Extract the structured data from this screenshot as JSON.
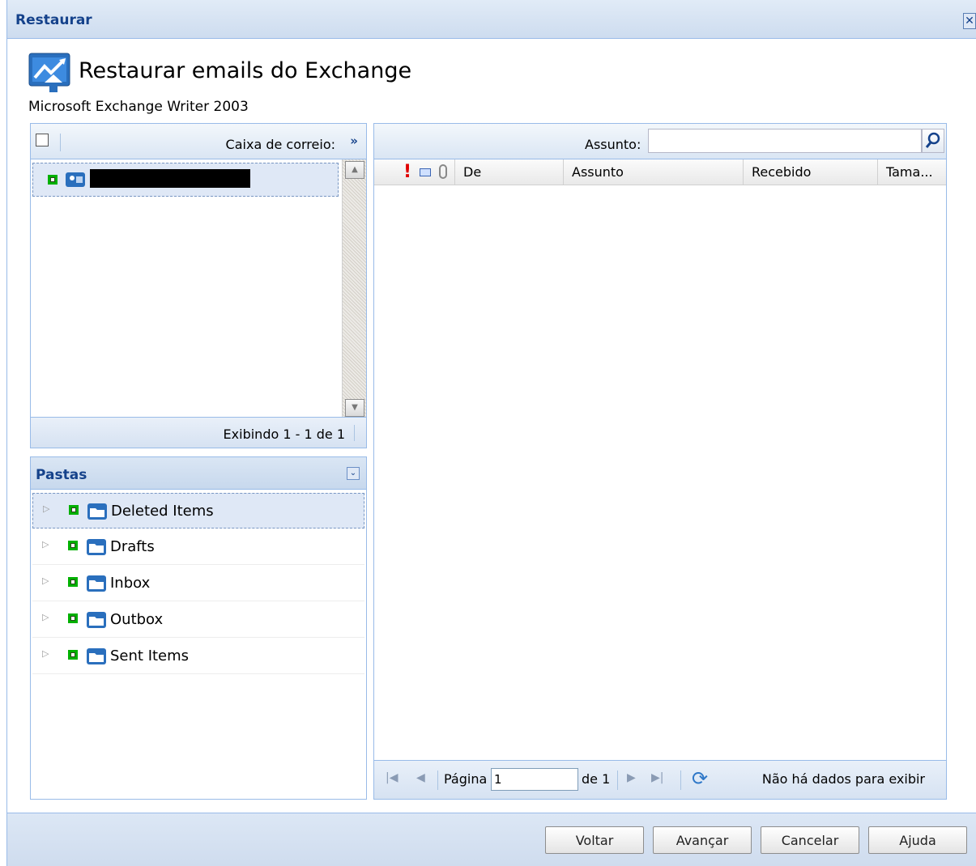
{
  "window": {
    "title": "Restaurar",
    "close_glyph": "✕"
  },
  "header": {
    "heading": "Restaurar emails do Exchange",
    "subheading": "Microsoft Exchange Writer 2003",
    "icon": "exchange-restore-icon"
  },
  "mailbox": {
    "label": "Caixa de correio:",
    "expand_glyph": "»",
    "rows": [
      {
        "name_redacted": true
      }
    ],
    "status": "Exibindo 1 - 1 de 1"
  },
  "folders": {
    "title": "Pastas",
    "collapse_glyph": "»",
    "items": [
      {
        "label": "Deleted Items"
      },
      {
        "label": "Drafts"
      },
      {
        "label": "Inbox"
      },
      {
        "label": "Outbox"
      },
      {
        "label": "Sent Items"
      }
    ]
  },
  "messages": {
    "search_label": "Assunto:",
    "search_value": "",
    "columns": {
      "de": "De",
      "assunto": "Assunto",
      "recebido": "Recebido",
      "tamanho": "Tama..."
    },
    "importance_glyph": "!",
    "pager": {
      "page_label": "Página",
      "page_value": "1",
      "of_label": "de 1",
      "no_data": "Não há dados para exibir"
    }
  },
  "footer": {
    "back": "Voltar",
    "next": "Avançar",
    "cancel": "Cancelar",
    "help": "Ajuda"
  },
  "colors": {
    "accent": "#15428b",
    "border": "#99bbe8",
    "checkbox_green": "#00b000",
    "importance_red": "#e00000"
  }
}
